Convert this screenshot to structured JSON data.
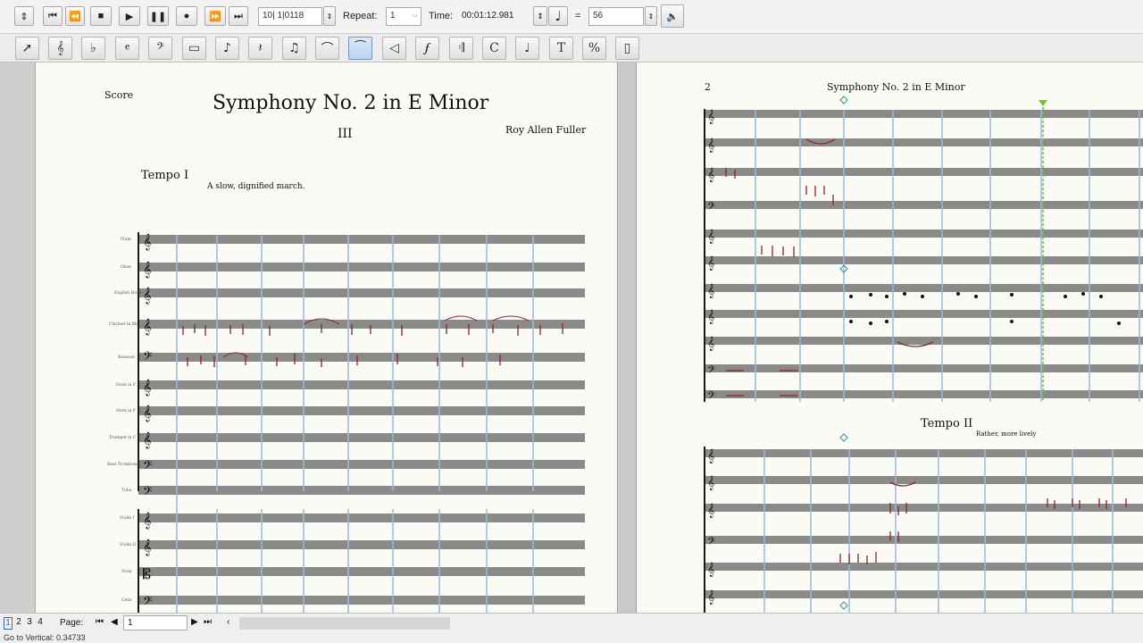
{
  "transport": {
    "location_value": "10| 1|0118",
    "repeat_label": "Repeat:",
    "repeat_value": "1",
    "time_label": "Time:",
    "time_value": "00:01:12.981",
    "tempo_value": "56"
  },
  "score": {
    "page1": {
      "header_left": "Score",
      "title": "Symphony No. 2 in E Minor",
      "movement": "III",
      "composer": "Roy Allen Fuller",
      "tempo_marking": "Tempo I",
      "expression": "A slow, dignified march."
    },
    "page2": {
      "page_number": "2",
      "running_title": "Symphony No. 2 in E Minor",
      "tempo_marking": "Tempo II",
      "expression": "Rather, more lively"
    }
  },
  "statusbar": {
    "page_tabs": [
      "1",
      "2",
      "3",
      "4"
    ],
    "page_label": "Page:",
    "page_value": "1",
    "message": "Go to Vertical: 0.34733"
  },
  "colors": {
    "accent": "#2f6fbf",
    "note_red": "#8b2232",
    "playback_cursor": "#7bbd3a",
    "barline_blue": "#9db7d6"
  }
}
